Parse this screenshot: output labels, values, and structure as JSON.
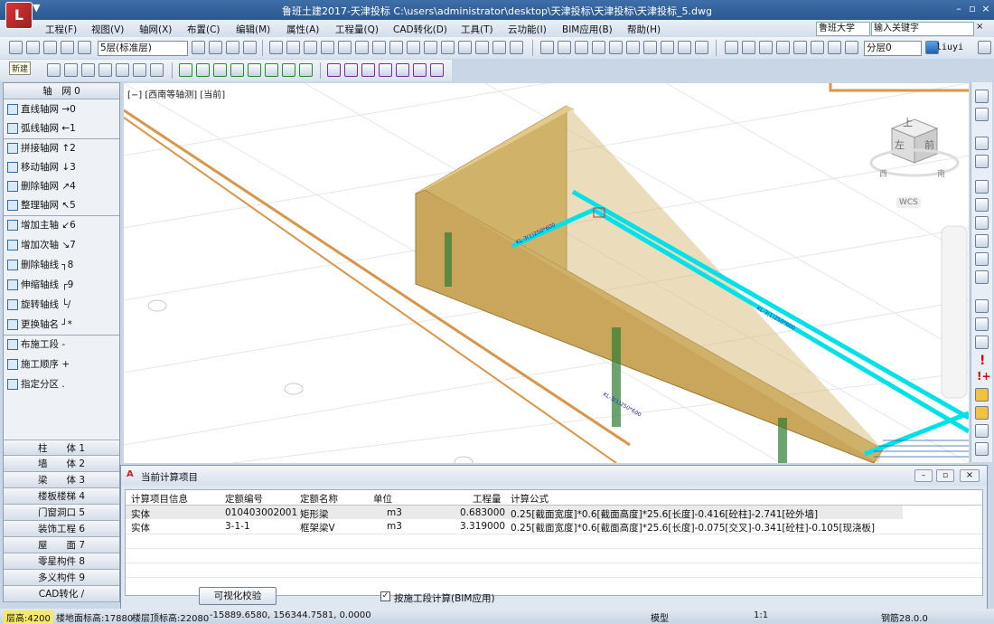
{
  "app": {
    "title": "鲁班土建2017-天津投标 C:\\users\\administrator\\desktop\\天津投标\\天津投标\\天津投标_5.dwg",
    "logo_text": "L"
  },
  "window_controls": {
    "minimize": "–",
    "restore": "▫",
    "close": "×"
  },
  "menu": [
    "工程(F)",
    "视图(V)",
    "轴网(X)",
    "布置(C)",
    "编辑(M)",
    "属性(A)",
    "工程量(Q)",
    "CAD转化(D)",
    "工具(T)",
    "云功能(I)",
    "BIM应用(B)",
    "帮助(H)"
  ],
  "search": {
    "scope": "鲁班大学",
    "placeholder": "输入关键字"
  },
  "toolbar": {
    "layer": "5层(标准层)",
    "floor": "分层0",
    "user": "liuyi",
    "new_tooltip": "新建"
  },
  "left_panel": {
    "header": "轴　网 0",
    "items": [
      {
        "label": "直线轴网",
        "key": "→0"
      },
      {
        "label": "弧线轴网",
        "key": "←1"
      },
      {
        "label": "拼接轴网",
        "key": "↑2"
      },
      {
        "label": "移动轴网",
        "key": "↓3"
      },
      {
        "label": "删除轴网",
        "key": "↗4"
      },
      {
        "label": "整理轴网",
        "key": "↖5"
      },
      {
        "label": "增加主轴",
        "key": "↙6"
      },
      {
        "label": "增加次轴",
        "key": "↘7"
      },
      {
        "label": "删除轴线",
        "key": "┐8"
      },
      {
        "label": "伸缩轴线",
        "key": "┌9"
      },
      {
        "label": "旋转轴线",
        "key": "└/"
      },
      {
        "label": "更换轴名",
        "key": "┘*"
      },
      {
        "label": "布施工段",
        "key": "-"
      },
      {
        "label": "施工顺序",
        "key": "+"
      },
      {
        "label": "指定分区",
        "key": "."
      }
    ],
    "categories": [
      "柱　　体 1",
      "墙　　体 2",
      "梁　　体 3",
      "楼板楼梯 4",
      "门窗洞口 5",
      "装饰工程 6",
      "屋　　面 7",
      "零星构件 8",
      "多义构件 9",
      "CAD转化 /"
    ]
  },
  "viewport": {
    "label": "[−] [西南等轴测] [当前]",
    "viewcube_top": "上",
    "viewcube_left": "左",
    "viewcube_front": "前",
    "wcs": "WCS",
    "compass": [
      "西",
      "南"
    ]
  },
  "dialog": {
    "title": "当前计算项目",
    "columns": [
      "计算项目信息",
      "定额编号",
      "定额名称",
      "单位",
      "工程量",
      "计算公式"
    ],
    "rows": [
      {
        "info": "实体",
        "code": "010403002001",
        "name": "矩形梁",
        "unit": "m3",
        "qty": "0.683000",
        "formula": "0.25[截面宽度]*0.6[截面高度]*25.6[长度]-0.416[砼柱]-2.741[砼外墙]"
      },
      {
        "info": "实体",
        "code": "3-1-1",
        "name": "框架梁V",
        "unit": "m3",
        "qty": "3.319000",
        "formula": "0.25[截面宽度]*0.6[截面高度]*25.6[长度]-0.075[交叉]-0.341[砼柱]-0.105[现浇板]"
      }
    ],
    "verify_button": "可视化校验",
    "bim_checkbox": "按施工段计算(BIM应用)",
    "bim_checked": true
  },
  "status": {
    "floor_height": "层高:4200",
    "floor_base": "楼地面标高:17880",
    "base_elev": "楼层顶标高:22080",
    "coords": "-15889.6580,  156344.7581,  0.0000",
    "model": "模型",
    "scale": "1:1",
    "sheet": "钢筋28.0.0"
  }
}
